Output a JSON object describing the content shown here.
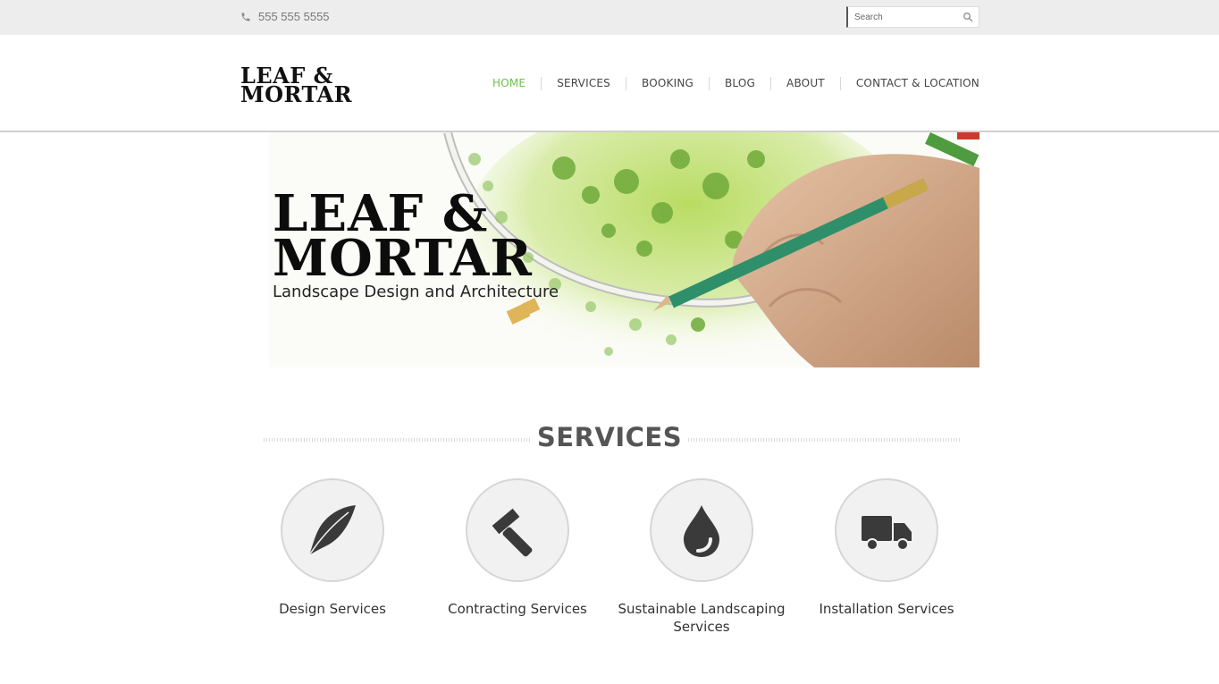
{
  "topbar": {
    "phone": "555 555 5555",
    "search_placeholder": "Search"
  },
  "header": {
    "logo_line1": "LEAF &",
    "logo_line2": "MORTAR",
    "nav": [
      {
        "label": "HOME",
        "active": true
      },
      {
        "label": "SERVICES",
        "active": false
      },
      {
        "label": "BOOKING",
        "active": false
      },
      {
        "label": "BLOG",
        "active": false
      },
      {
        "label": "ABOUT",
        "active": false
      },
      {
        "label": "CONTACT & LOCATION",
        "active": false
      }
    ]
  },
  "hero": {
    "title_line1": "LEAF &",
    "title_line2": "MORTAR",
    "subtitle": "Landscape Design and Architecture"
  },
  "services": {
    "heading": "SERVICES",
    "items": [
      {
        "label": "Design Services",
        "icon": "feather-icon"
      },
      {
        "label": "Contracting Services",
        "icon": "hammer-icon"
      },
      {
        "label": "Sustainable Landscaping Services",
        "icon": "water-drop-icon"
      },
      {
        "label": "Installation Services",
        "icon": "truck-icon"
      }
    ]
  },
  "colors": {
    "accent": "#6cc24a",
    "topbar": "#ededed",
    "icon": "#3a3a3a"
  }
}
